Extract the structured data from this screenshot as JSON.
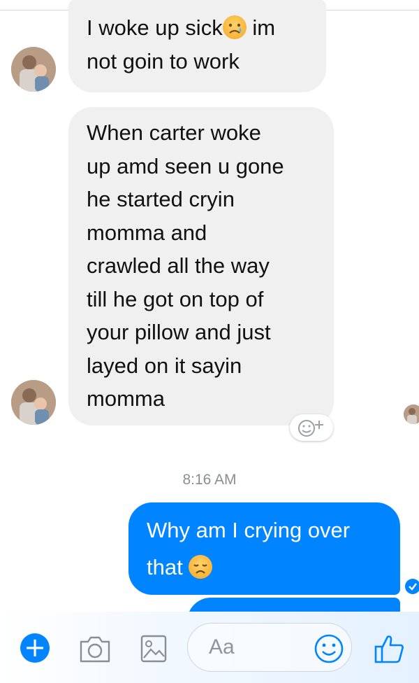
{
  "conversation": {
    "messages": [
      {
        "direction": "incoming",
        "lines": [
          "I woke up sick",
          "not goin to work"
        ],
        "inline_emoji_after_first_segment": "sad-tear-emoji",
        "first_line_tail": "im"
      },
      {
        "direction": "incoming",
        "lines": [
          "When carter woke",
          "up amd seen u gone",
          "he started cryin",
          "momma and",
          "crawled all the way",
          "till he got on top of",
          "your pillow and just",
          "layed on it sayin",
          "momma"
        ]
      },
      {
        "direction": "outgoing",
        "lines": [
          "Why am I crying over",
          "that"
        ],
        "trailing_emoji": "disappointed-face-emoji"
      }
    ],
    "timestamp": "8:16 AM"
  },
  "composer": {
    "placeholder": "Aa",
    "icons": [
      "plus-icon",
      "camera-icon",
      "image-icon",
      "smiley-icon",
      "thumbs-up-icon"
    ]
  },
  "colors": {
    "outgoing_bubble": "#0084ff",
    "incoming_bubble": "#f1f0f0",
    "timestamp_text": "#8a8d91"
  }
}
